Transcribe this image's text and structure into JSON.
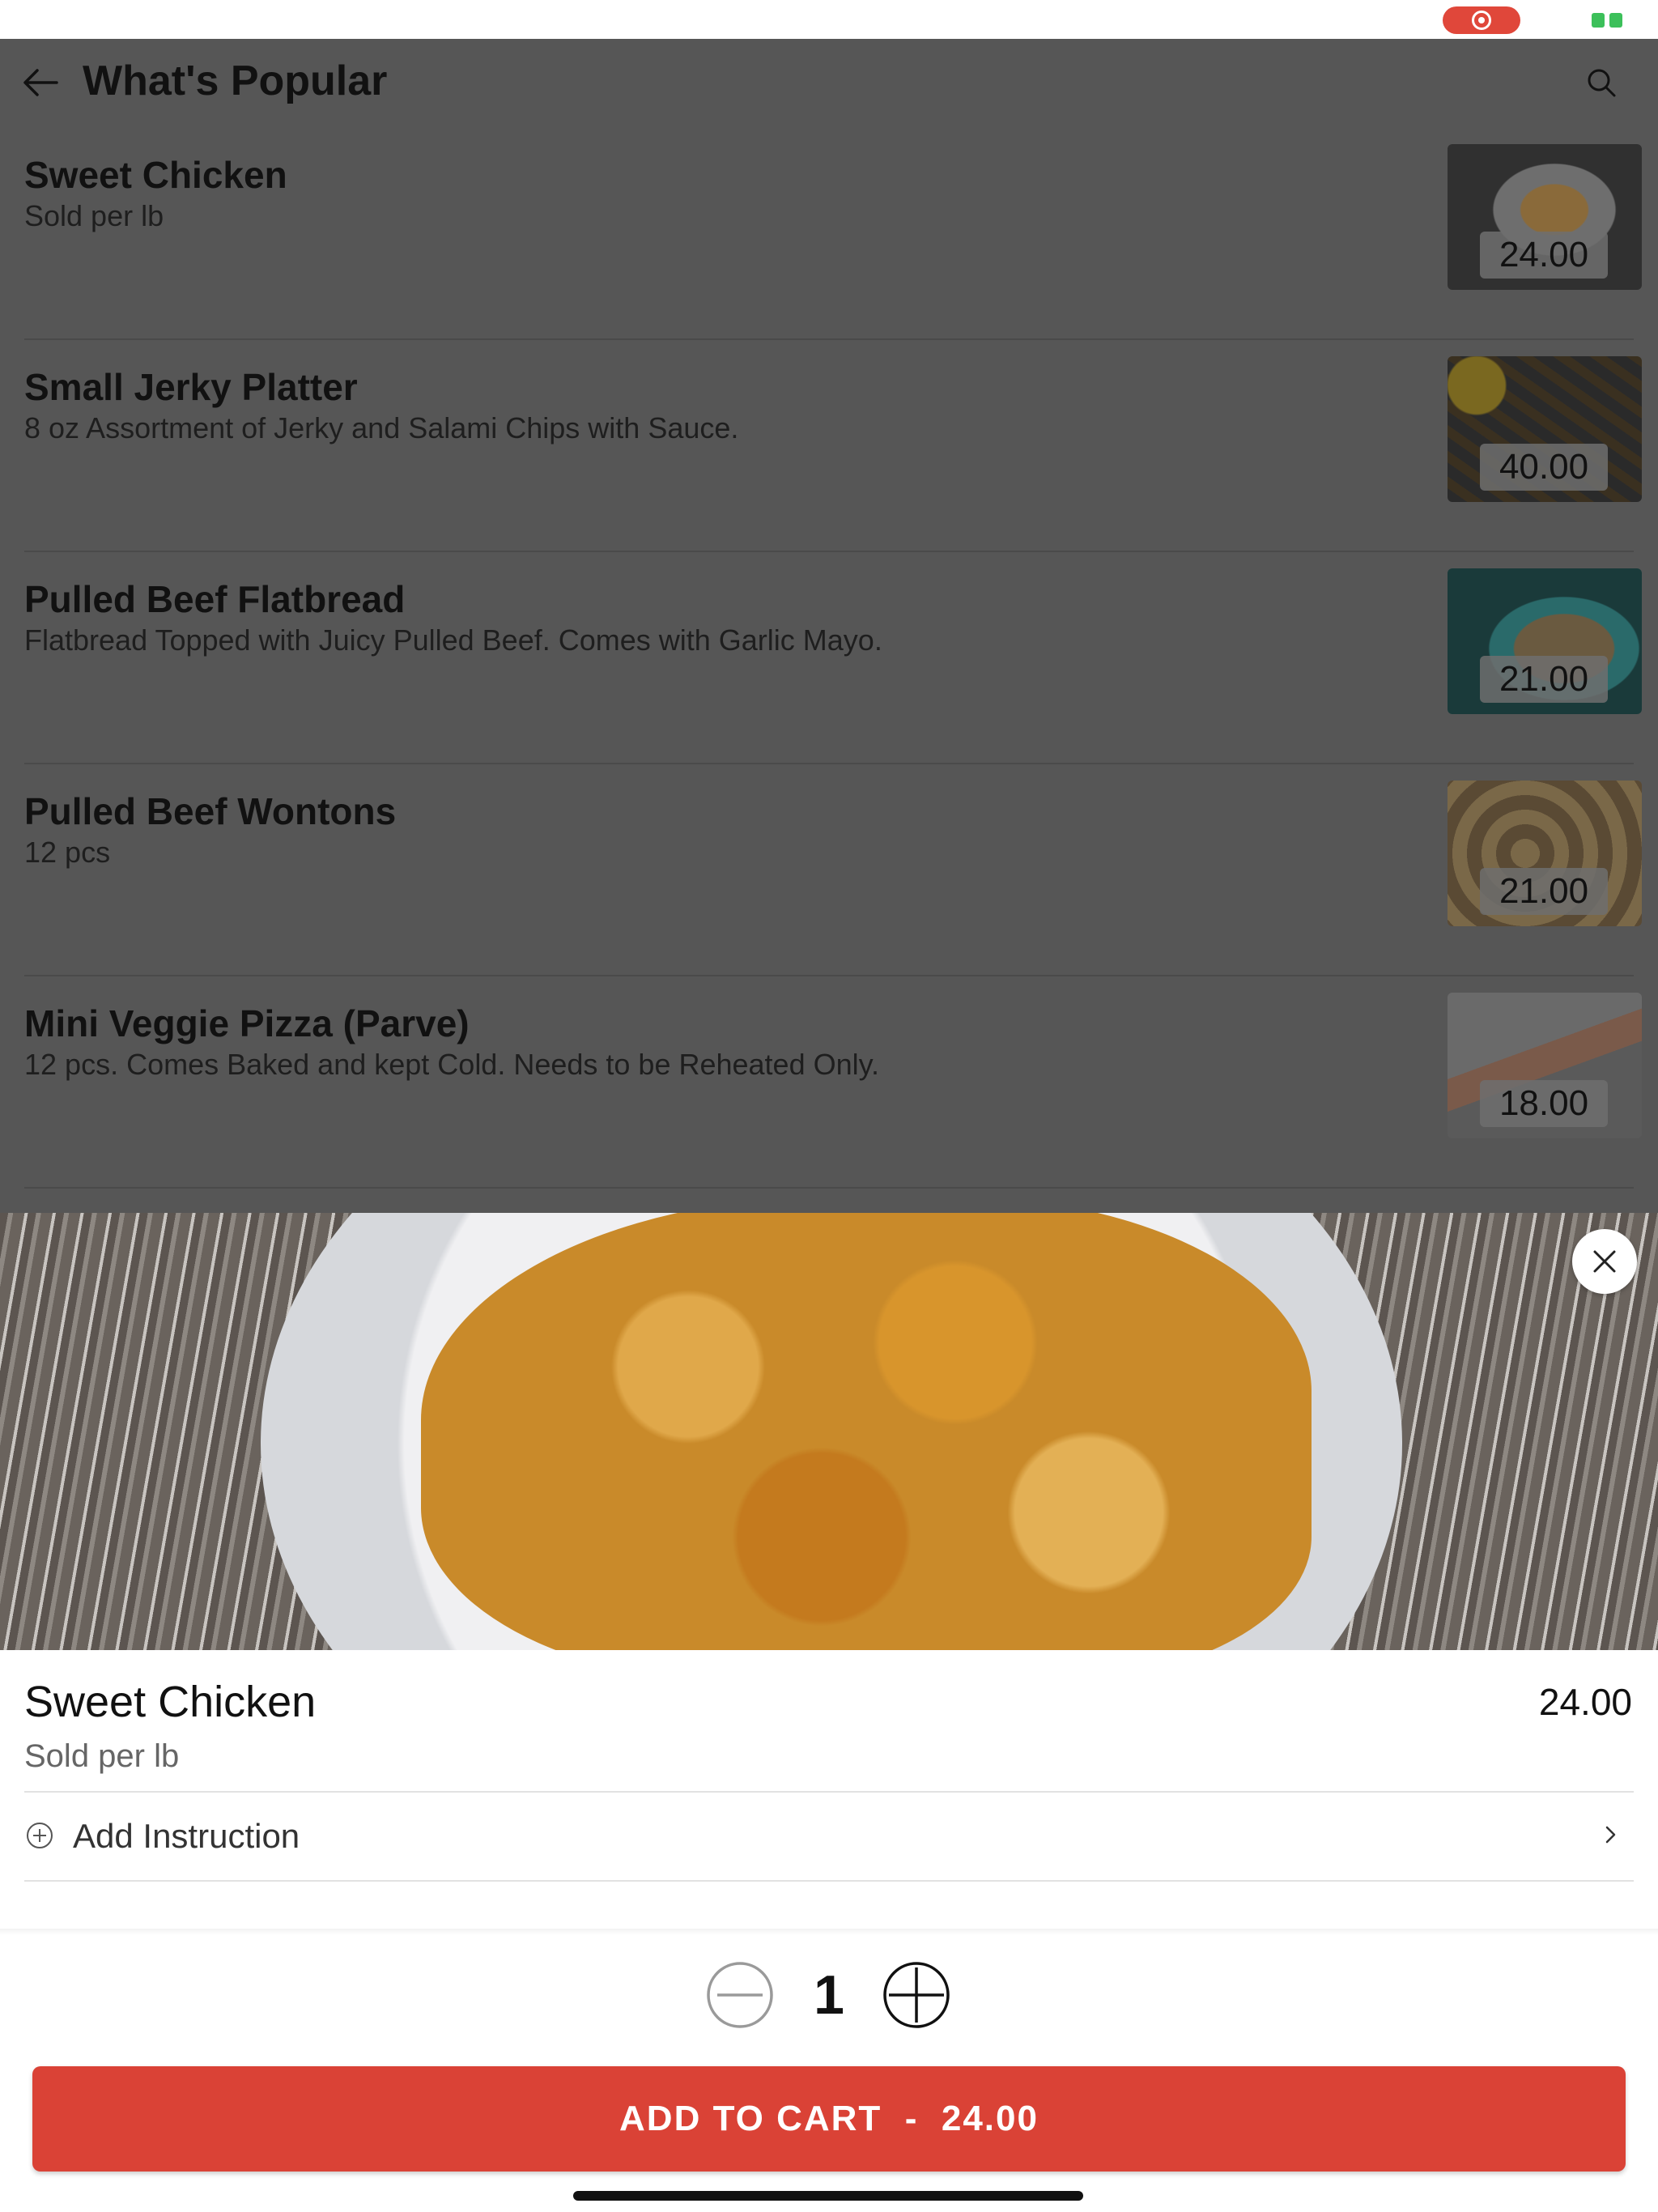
{
  "header": {
    "title": "What's Popular"
  },
  "items": [
    {
      "name": "Sweet Chicken",
      "description": "Sold per lb",
      "price": "24.00"
    },
    {
      "name": "Small Jerky Platter",
      "description": "8 oz Assortment of Jerky and Salami Chips with Sauce.",
      "price": "40.00"
    },
    {
      "name": "Pulled Beef Flatbread",
      "description": "Flatbread Topped with Juicy Pulled Beef. Comes with Garlic Mayo.",
      "price": "21.00"
    },
    {
      "name": "Pulled Beef Wontons",
      "description": "12 pcs",
      "price": "21.00"
    },
    {
      "name": "Mini Veggie Pizza (Parve)",
      "description": "12 pcs. Comes Baked and kept Cold. Needs to be Reheated Only.",
      "price": "18.00"
    }
  ],
  "detail": {
    "name": "Sweet Chicken",
    "price": "24.00",
    "description": "Sold per lb",
    "add_instruction_label": "Add Instruction",
    "quantity": "1",
    "add_to_cart_label": "ADD TO CART  -  24.00"
  },
  "colors": {
    "accent": "#da4236",
    "overlay": "#565656",
    "record_indicator": "#e0473a",
    "battery": "#3cc05a"
  },
  "icons": [
    "back-arrow-icon",
    "search-icon",
    "close-icon",
    "plus-circle-icon",
    "chevron-right-icon",
    "minus-circle-icon",
    "plus-icon",
    "record-icon",
    "battery-icon"
  ]
}
